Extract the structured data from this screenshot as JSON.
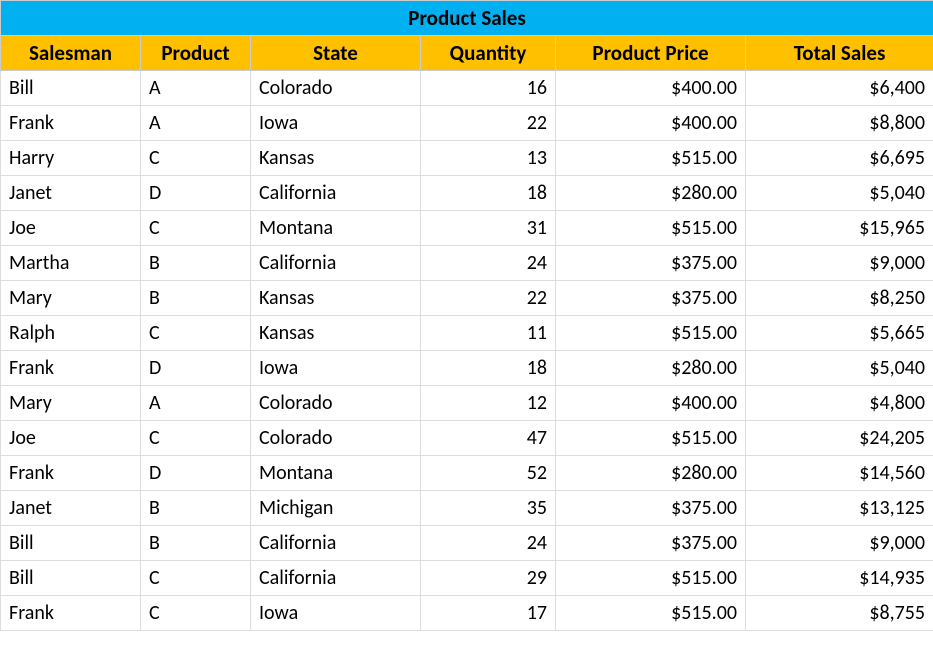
{
  "table": {
    "title": "Product Sales",
    "headers": {
      "salesman": "Salesman",
      "product": "Product",
      "state": "State",
      "quantity": "Quantity",
      "price": "Product Price",
      "total": "Total Sales"
    },
    "rows": [
      {
        "salesman": "Bill",
        "product": "A",
        "state": "Colorado",
        "quantity": "16",
        "price": "$400.00",
        "total": "$6,400"
      },
      {
        "salesman": "Frank",
        "product": "A",
        "state": "Iowa",
        "quantity": "22",
        "price": "$400.00",
        "total": "$8,800"
      },
      {
        "salesman": "Harry",
        "product": "C",
        "state": "Kansas",
        "quantity": "13",
        "price": "$515.00",
        "total": "$6,695"
      },
      {
        "salesman": "Janet",
        "product": "D",
        "state": "California",
        "quantity": "18",
        "price": "$280.00",
        "total": "$5,040"
      },
      {
        "salesman": "Joe",
        "product": "C",
        "state": "Montana",
        "quantity": "31",
        "price": "$515.00",
        "total": "$15,965"
      },
      {
        "salesman": "Martha",
        "product": "B",
        "state": "California",
        "quantity": "24",
        "price": "$375.00",
        "total": "$9,000"
      },
      {
        "salesman": "Mary",
        "product": "B",
        "state": "Kansas",
        "quantity": "22",
        "price": "$375.00",
        "total": "$8,250"
      },
      {
        "salesman": "Ralph",
        "product": "C",
        "state": "Kansas",
        "quantity": "11",
        "price": "$515.00",
        "total": "$5,665"
      },
      {
        "salesman": "Frank",
        "product": "D",
        "state": "Iowa",
        "quantity": "18",
        "price": "$280.00",
        "total": "$5,040"
      },
      {
        "salesman": "Mary",
        "product": "A",
        "state": "Colorado",
        "quantity": "12",
        "price": "$400.00",
        "total": "$4,800"
      },
      {
        "salesman": "Joe",
        "product": "C",
        "state": "Colorado",
        "quantity": "47",
        "price": "$515.00",
        "total": "$24,205"
      },
      {
        "salesman": "Frank",
        "product": "D",
        "state": "Montana",
        "quantity": "52",
        "price": "$280.00",
        "total": "$14,560"
      },
      {
        "salesman": "Janet",
        "product": "B",
        "state": "Michigan",
        "quantity": "35",
        "price": "$375.00",
        "total": "$13,125"
      },
      {
        "salesman": "Bill",
        "product": "B",
        "state": "California",
        "quantity": "24",
        "price": "$375.00",
        "total": "$9,000"
      },
      {
        "salesman": "Bill",
        "product": "C",
        "state": "California",
        "quantity": "29",
        "price": "$515.00",
        "total": "$14,935"
      },
      {
        "salesman": "Frank",
        "product": "C",
        "state": "Iowa",
        "quantity": "17",
        "price": "$515.00",
        "total": "$8,755"
      }
    ]
  }
}
